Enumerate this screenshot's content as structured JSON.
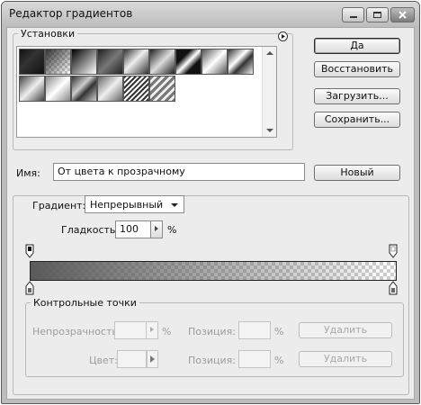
{
  "window": {
    "title": "Редактор градиентов"
  },
  "buttons": {
    "ok": "Да",
    "reset": "Восстановить",
    "load": "Загрузить...",
    "save": "Сохранить...",
    "new": "Новый"
  },
  "presets": {
    "label": "Установки",
    "count": 15
  },
  "name": {
    "label": "Имя:",
    "value": "От цвета к прозрачному"
  },
  "gradient": {
    "type_label": "Градиент:",
    "type_value": "Непрерывный",
    "smoothness_label": "Гладкость:",
    "smoothness_value": "100",
    "unit": "%"
  },
  "stops": {
    "label": "Контрольные точки",
    "opacity_label": "Непрозрачность:",
    "opacity_unit": "%",
    "position_label": "Позиция:",
    "position_unit": "%",
    "delete_label": "Удалить",
    "color_label": "Цвет:"
  }
}
